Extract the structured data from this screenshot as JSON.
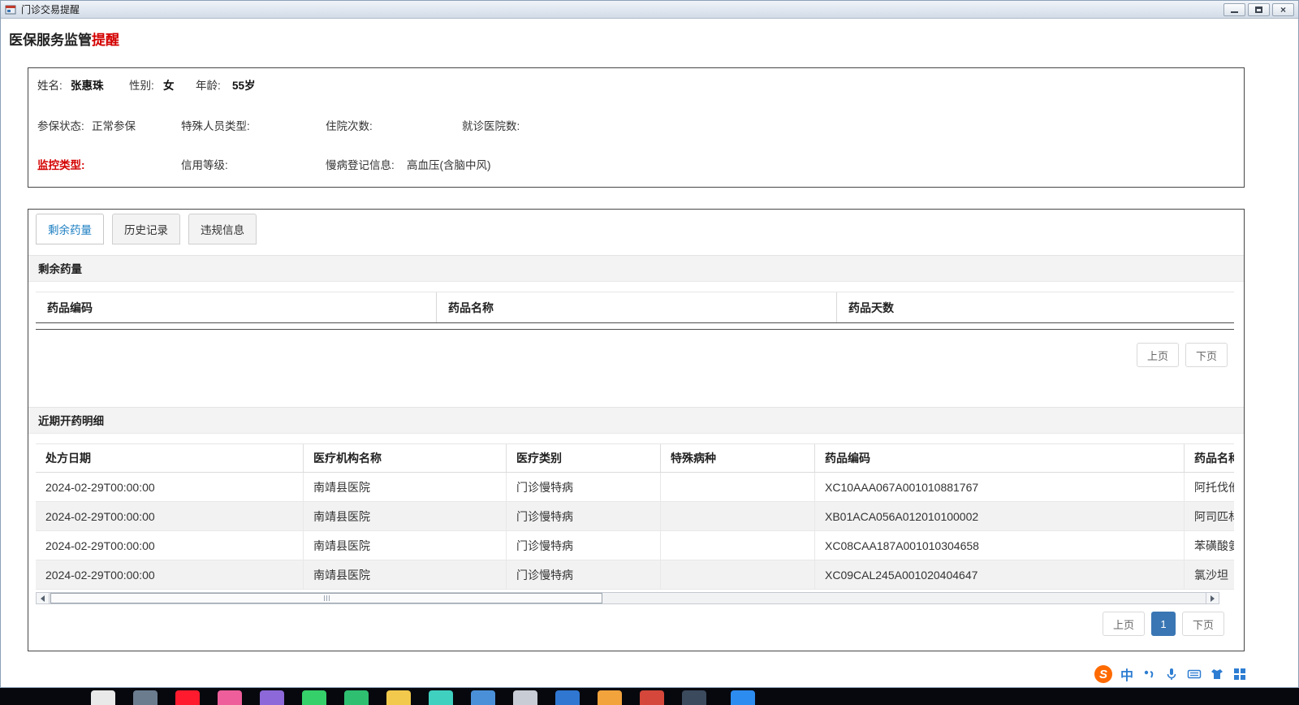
{
  "window": {
    "title": "门诊交易提醒"
  },
  "page_title": {
    "black": "医保服务监管",
    "red": "提醒"
  },
  "patient": {
    "name_label": "姓名:",
    "name_value": "张惠珠",
    "gender_label": "性别:",
    "gender_value": "女",
    "age_label": "年龄:",
    "age_value": "55岁",
    "insured_label": "参保状态:",
    "insured_value": "正常参保",
    "special_label": "特殊人员类型:",
    "special_value": "",
    "admissions_label": "住院次数:",
    "admissions_value": "",
    "hospitals_label": "就诊医院数:",
    "hospitals_value": "",
    "monitor_label": "监控类型:",
    "monitor_value": "",
    "credit_label": "信用等级:",
    "credit_value": "",
    "chronic_label": "慢病登记信息:",
    "chronic_value": "高血压(含脑中风)"
  },
  "tabs": [
    {
      "label": "剩余药量"
    },
    {
      "label": "历史记录"
    },
    {
      "label": "违规信息"
    }
  ],
  "remaining_section": {
    "title": "剩余药量",
    "columns": [
      "药品编码",
      "药品名称",
      "药品天数"
    ],
    "prev": "上页",
    "next": "下页"
  },
  "recent_section": {
    "title": "近期开药明细",
    "columns": [
      "处方日期",
      "医疗机构名称",
      "医疗类别",
      "特殊病种",
      "药品编码",
      "药品名称"
    ],
    "rows": [
      [
        "2024-02-29T00:00:00",
        "南靖县医院",
        "门诊慢特病",
        "",
        "XC10AAA067A001010881767",
        "阿托伐他"
      ],
      [
        "2024-02-29T00:00:00",
        "南靖县医院",
        "门诊慢特病",
        "",
        "XB01ACA056A012010100002",
        "阿司匹林"
      ],
      [
        "2024-02-29T00:00:00",
        "南靖县医院",
        "门诊慢特病",
        "",
        "XC08CAA187A001010304658",
        "苯磺酸氨"
      ],
      [
        "2024-02-29T00:00:00",
        "南靖县医院",
        "门诊慢特病",
        "",
        "XC09CAL245A001020404647",
        "氯沙坦"
      ]
    ],
    "prev": "上页",
    "page": "1",
    "next": "下页"
  },
  "ime": {
    "logo": "S",
    "mode": "中"
  },
  "colors": {
    "accent_red": "#d40000",
    "tab_active": "#1b7ec2",
    "page_active_bg": "#3a76b4"
  }
}
